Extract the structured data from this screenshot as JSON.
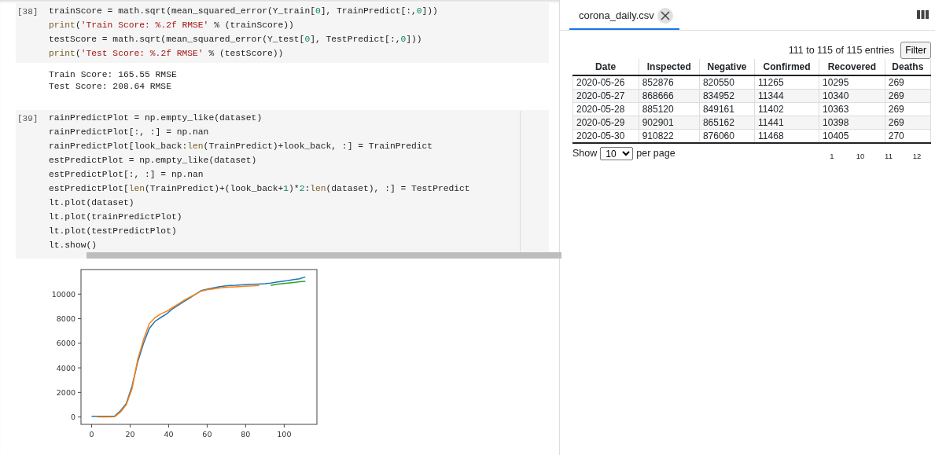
{
  "cells": [
    {
      "prompt": "[38]",
      "lines": [
        [
          {
            "t": "trainScore = math.sqrt(mean_squared_error(Y_train[",
            "kind": "plain"
          },
          {
            "t": "0",
            "kind": "number"
          },
          {
            "t": "], TrainPredict[:,",
            "kind": "plain"
          },
          {
            "t": "0",
            "kind": "number"
          },
          {
            "t": "]))",
            "kind": "plain"
          }
        ],
        [
          {
            "t": "print",
            "kind": "builtin"
          },
          {
            "t": "(",
            "kind": "plain"
          },
          {
            "t": "'Train Score: %.2f RMSE'",
            "kind": "string"
          },
          {
            "t": " % (trainScore))",
            "kind": "plain"
          }
        ],
        [
          {
            "t": "testScore = math.sqrt(mean_squared_error(Y_test[",
            "kind": "plain"
          },
          {
            "t": "0",
            "kind": "number"
          },
          {
            "t": "], TestPredict[:,",
            "kind": "plain"
          },
          {
            "t": "0",
            "kind": "number"
          },
          {
            "t": "]))",
            "kind": "plain"
          }
        ],
        [
          {
            "t": "print",
            "kind": "builtin"
          },
          {
            "t": "(",
            "kind": "plain"
          },
          {
            "t": "'Test Score: %.2f RMSE'",
            "kind": "string"
          },
          {
            "t": " % (testScore))",
            "kind": "plain"
          }
        ]
      ],
      "output": [
        "Train Score: 165.55 RMSE",
        "Test Score: 208.64 RMSE"
      ]
    },
    {
      "prompt": "[39]",
      "lines": [
        [
          {
            "t": "rainPredictPlot = np.empty_like(dataset)",
            "kind": "plain"
          }
        ],
        [
          {
            "t": "rainPredictPlot[:, :] = np.nan",
            "kind": "plain"
          }
        ],
        [
          {
            "t": "rainPredictPlot[look_back:",
            "kind": "plain"
          },
          {
            "t": "len",
            "kind": "builtin"
          },
          {
            "t": "(TrainPredict)+look_back, :] = TrainPredict",
            "kind": "plain"
          }
        ],
        [
          {
            "t": "estPredictPlot = np.empty_like(dataset)",
            "kind": "plain"
          }
        ],
        [
          {
            "t": "estPredictPlot[:, :] = np.nan",
            "kind": "plain"
          }
        ],
        [
          {
            "t": "estPredictPlot[",
            "kind": "plain"
          },
          {
            "t": "len",
            "kind": "builtin"
          },
          {
            "t": "(TrainPredict)+(look_back+",
            "kind": "plain"
          },
          {
            "t": "1",
            "kind": "number"
          },
          {
            "t": ")*",
            "kind": "plain"
          },
          {
            "t": "2",
            "kind": "number"
          },
          {
            "t": ":",
            "kind": "plain"
          },
          {
            "t": "len",
            "kind": "builtin"
          },
          {
            "t": "(dataset), :] = TestPredict",
            "kind": "plain"
          }
        ],
        [
          {
            "t": "lt.plot(dataset)",
            "kind": "plain"
          }
        ],
        [
          {
            "t": "lt.plot(trainPredictPlot)",
            "kind": "plain"
          }
        ],
        [
          {
            "t": "lt.plot(testPredictPlot)",
            "kind": "plain"
          }
        ],
        [
          {
            "t": "lt.show()",
            "kind": "plain"
          }
        ]
      ],
      "chart_data": {
        "type": "line",
        "x": [
          0,
          3,
          6,
          9,
          12,
          15,
          18,
          21,
          24,
          27,
          30,
          33,
          36,
          39,
          42,
          45,
          48,
          51,
          54,
          57,
          60,
          63,
          66,
          69,
          72,
          75,
          78,
          81,
          84,
          87,
          90,
          93,
          96,
          99,
          102,
          105,
          108,
          111
        ],
        "series": [
          {
            "color": "#1f77b4",
            "values": [
              50,
              50,
              50,
              50,
              80,
              500,
              1100,
              2500,
              4500,
              6000,
              7200,
              7800,
              8100,
              8400,
              8800,
              9100,
              9400,
              9700,
              10000,
              10300,
              10400,
              10500,
              10600,
              10650,
              10700,
              10720,
              10750,
              10780,
              10800,
              10820,
              10850,
              10900,
              10980,
              11050,
              11100,
              11180,
              11250,
              11400
            ]
          },
          {
            "color": "#ff7f0e",
            "values": [
              null,
              0,
              0,
              0,
              30,
              400,
              1000,
              2300,
              4700,
              6300,
              7600,
              8100,
              8400,
              8600,
              8900,
              9200,
              9500,
              9750,
              10000,
              10250,
              10350,
              10420,
              10500,
              10550,
              10580,
              10600,
              10620,
              10650,
              10670,
              10700,
              null,
              null,
              null,
              null,
              null,
              null,
              null,
              null
            ]
          },
          {
            "color": "#2ca02c",
            "values": [
              null,
              null,
              null,
              null,
              null,
              null,
              null,
              null,
              null,
              null,
              null,
              null,
              null,
              null,
              null,
              null,
              null,
              null,
              null,
              null,
              null,
              null,
              null,
              null,
              null,
              null,
              null,
              null,
              null,
              null,
              null,
              10700,
              10800,
              10850,
              10900,
              10950,
              11000,
              11050
            ]
          }
        ],
        "xlim": [
          -5.5,
          117
        ],
        "ylim": [
          -600,
          12000
        ],
        "xticks": [
          {
            "value": 0,
            "label": "0"
          },
          {
            "value": 20,
            "label": "20"
          },
          {
            "value": 40,
            "label": "40"
          },
          {
            "value": 60,
            "label": "60"
          },
          {
            "value": 80,
            "label": "80"
          },
          {
            "value": 100,
            "label": "100"
          }
        ],
        "yticks": [
          {
            "value": 0,
            "label": "0"
          },
          {
            "value": 2000,
            "label": "2000"
          },
          {
            "value": 4000,
            "label": "4000"
          },
          {
            "value": 6000,
            "label": "6000"
          },
          {
            "value": 8000,
            "label": "8000"
          },
          {
            "value": 10000,
            "label": "10000"
          }
        ]
      }
    }
  ],
  "viewer": {
    "tab": {
      "label": "corona_daily.csv",
      "selected": true
    },
    "summary": "111 to 115 of 115 entries",
    "filter_button": "Filter",
    "columns": [
      "Date",
      "Inspected",
      "Negative",
      "Confirmed",
      "Recovered",
      "Deaths"
    ],
    "rows": [
      [
        "2020-05-26",
        "852876",
        "820550",
        "11265",
        "10295",
        "269"
      ],
      [
        "2020-05-27",
        "868666",
        "834952",
        "11344",
        "10340",
        "269"
      ],
      [
        "2020-05-28",
        "885120",
        "849161",
        "11402",
        "10363",
        "269"
      ],
      [
        "2020-05-29",
        "902901",
        "865162",
        "11441",
        "10398",
        "269"
      ],
      [
        "2020-05-30",
        "910822",
        "876060",
        "11468",
        "10405",
        "270"
      ]
    ],
    "show_label": "Show",
    "page_size": "10",
    "per_page_label": "per page",
    "pages": [
      "1",
      "10",
      "11",
      "12"
    ]
  }
}
